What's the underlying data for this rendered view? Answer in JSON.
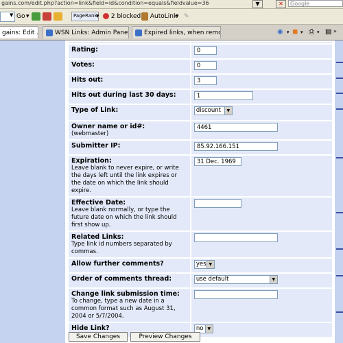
{
  "address_bar": {
    "url": "gains.com/edit.php?action=link&field=id&condition=equals&fieldvalue=36",
    "search_placeholder": "Google"
  },
  "toolbar": {
    "go_label": "Go",
    "pagerank_label": "PageRank",
    "blocked_label": "2 blocked",
    "autolink_label": "AutoLink"
  },
  "tabs": [
    {
      "label": "gains: Edit ..."
    },
    {
      "label": "WSN Links: Admin Panel"
    },
    {
      "label": "Expired links, when removed..."
    }
  ],
  "form": {
    "rating": {
      "label": "Rating:",
      "value": "0"
    },
    "votes": {
      "label": "Votes:",
      "value": "0"
    },
    "hits_out": {
      "label": "Hits out:",
      "value": "3"
    },
    "hits_30": {
      "label": "Hits out during last 30 days:",
      "value": "1"
    },
    "type": {
      "label": "Type of Link:",
      "value": "discount"
    },
    "owner": {
      "label": "Owner name or id#:",
      "hint": "(webmaster)",
      "value": "4461"
    },
    "submitter_ip": {
      "label": "Submitter IP:",
      "value": "85.92.166.151"
    },
    "expiration": {
      "label": "Expiration:",
      "hint": "Leave blank to never expire, or write the days left until the link expires or the date on which the link should expire.",
      "value": "31 Dec. 1969"
    },
    "effective": {
      "label": "Effective Date:",
      "hint": "Leave blank normally, or type the future date on which the link should first show up.",
      "value": ""
    },
    "related": {
      "label": "Related Links:",
      "hint": "Type link id numbers separated by commas.",
      "value": ""
    },
    "comments": {
      "label": "Allow further comments?",
      "value": "yes"
    },
    "order": {
      "label": "Order of comments thread:",
      "value": "use default"
    },
    "change_time": {
      "label": "Change link submission time:",
      "hint": "To change, type a new date in a common format such as August 31, 2004 or 5/7/2004.",
      "value": ""
    },
    "hide": {
      "label": "Hide Link?",
      "value": "no"
    }
  },
  "buttons": {
    "save": "Save Changes",
    "preview": "Preview Changes"
  }
}
